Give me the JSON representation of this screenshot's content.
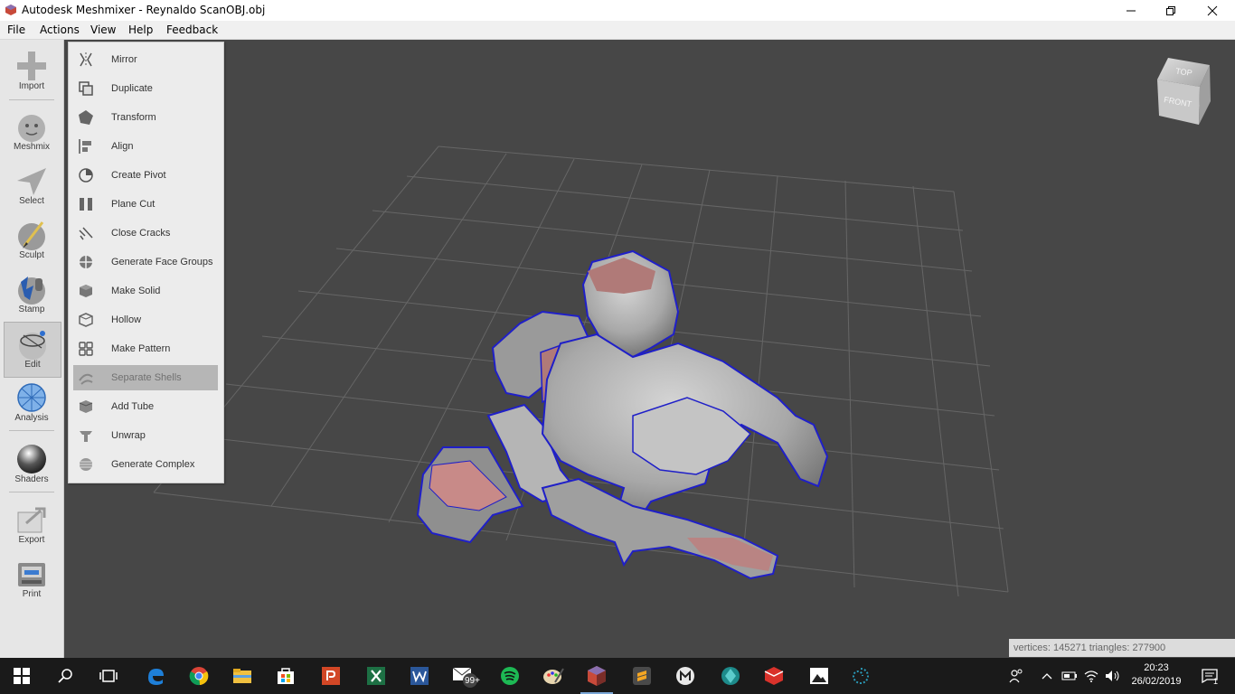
{
  "window": {
    "title": "Autodesk Meshmixer - Reynaldo ScanOBJ.obj"
  },
  "menubar": [
    "File",
    "Actions",
    "View",
    "Help",
    "Feedback"
  ],
  "toolbar": [
    {
      "label": "Import",
      "icon": "plus-icon"
    },
    {
      "label": "Meshmix",
      "icon": "meshmix-bunny-icon"
    },
    {
      "label": "Select",
      "icon": "select-arrow-icon"
    },
    {
      "label": "Sculpt",
      "icon": "sculpt-brush-icon"
    },
    {
      "label": "Stamp",
      "icon": "stamp-icon"
    },
    {
      "label": "Edit",
      "icon": "edit-sphere-icon",
      "active": true
    },
    {
      "label": "Analysis",
      "icon": "analysis-mesh-icon"
    },
    {
      "label": "Shaders",
      "icon": "shader-ball-icon"
    },
    {
      "label": "Export",
      "icon": "export-icon"
    },
    {
      "label": "Print",
      "icon": "printer-icon"
    }
  ],
  "edit_menu": [
    {
      "label": "Mirror",
      "icon": "mirror-icon"
    },
    {
      "label": "Duplicate",
      "icon": "duplicate-icon"
    },
    {
      "label": "Transform",
      "icon": "transform-icon"
    },
    {
      "label": "Align",
      "icon": "align-icon"
    },
    {
      "label": "Create Pivot",
      "icon": "pivot-icon"
    },
    {
      "label": "Plane Cut",
      "icon": "plane-cut-icon"
    },
    {
      "label": "Close Cracks",
      "icon": "close-cracks-icon"
    },
    {
      "label": "Generate Face Groups",
      "icon": "face-groups-icon"
    },
    {
      "label": "Make Solid",
      "icon": "make-solid-icon"
    },
    {
      "label": "Hollow",
      "icon": "hollow-icon"
    },
    {
      "label": "Make Pattern",
      "icon": "pattern-icon"
    },
    {
      "label": "Separate Shells",
      "icon": "separate-shells-icon",
      "selected": true
    },
    {
      "label": "Add Tube",
      "icon": "add-tube-icon"
    },
    {
      "label": "Unwrap",
      "icon": "unwrap-icon"
    },
    {
      "label": "Generate Complex",
      "icon": "complex-icon"
    }
  ],
  "viewcube": {
    "top": "TOP",
    "front": "FRONT"
  },
  "status": {
    "stats": "vertices: 145271 triangles: 277900"
  },
  "taskbar": {
    "apps": [
      "start-icon",
      "search-icon",
      "task-view-icon",
      "edge-icon",
      "chrome-icon",
      "file-explorer-icon",
      "store-icon",
      "powerpoint-icon",
      "excel-icon",
      "word-icon",
      "mail-icon",
      "spotify-icon",
      "paint-icon",
      "meshmixer-icon",
      "sublime-icon",
      "app-m-icon",
      "app-globe-icon",
      "sketchup-icon",
      "photos-icon",
      "app-swirl-icon"
    ],
    "mail_badge": "99+",
    "time": "20:23",
    "date": "26/02/2019",
    "notif_count": "1"
  },
  "colors": {
    "viewport": "#474747",
    "boundary": "#1f1fc8",
    "highlight": "#c88a88"
  }
}
